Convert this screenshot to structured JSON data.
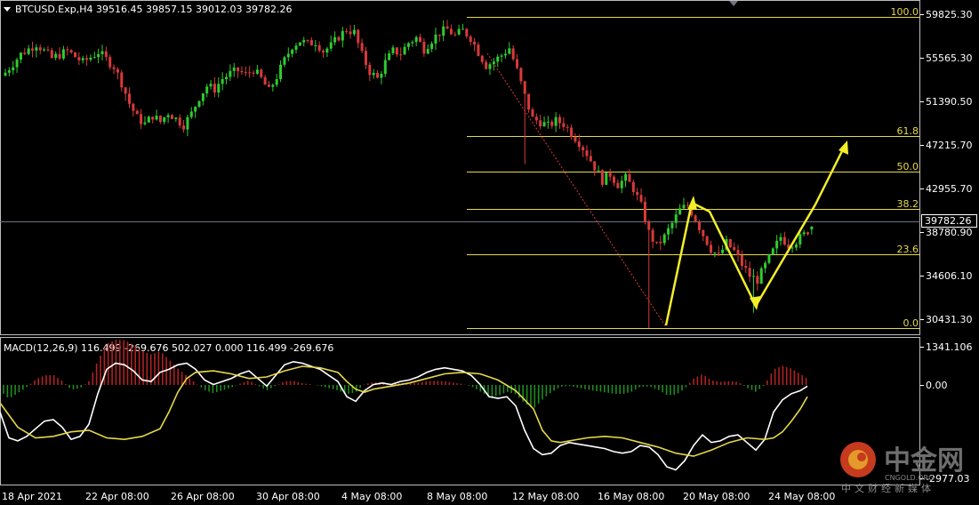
{
  "header": {
    "symbol_line": "BTCUSD.Exp,H4  39516.45 39857.15 39012.03 39782.26"
  },
  "price_axis": {
    "labels": [
      "59825.30",
      "55565.30",
      "51390.50",
      "47215.70",
      "42955.70",
      "38780.90",
      "34606.10",
      "30431.30"
    ],
    "current": "39782.26"
  },
  "fibonacci": {
    "levels": [
      "100.0",
      "61.8",
      "50.0",
      "38.2",
      "23.6",
      "0.0"
    ]
  },
  "macd": {
    "label": "MACD(12,26,9) 116.499 -269.676 502.027 0.000 116.499 -269.676",
    "axis_labels": [
      "1341.106",
      "0.00",
      "-2977.03"
    ]
  },
  "time_axis": {
    "labels": [
      "18 Apr 2021",
      "22 Apr 08:00",
      "26 Apr 08:00",
      "30 Apr 08:00",
      "4 May 08:00",
      "8 May 08:00",
      "12 May 08:00",
      "16 May 08:00",
      "20 May 08:00",
      "24 May 08:00"
    ]
  },
  "watermark": {
    "brand": "中金网",
    "domain": "CNGOLD.ORG",
    "tagline": "中文财经新媒体"
  },
  "colors": {
    "background": "#000000",
    "bull_candle": "#2ecc2e",
    "bear_candle": "#d83a3a",
    "fib_line": "#e6d84a",
    "arrow": "#f2ee2a",
    "macd_hist_pos": "#b02222",
    "macd_hist_neg": "#1e8c1e",
    "macd_line": "#ffffff",
    "signal_line": "#e6d84a",
    "trend_line": "#d83a3a"
  },
  "chart_data": {
    "type": "candlestick",
    "title": "BTCUSD.Exp,H4",
    "timeframe": "H4",
    "last_bar": {
      "open": 39516.45,
      "high": 39857.15,
      "low": 39012.03,
      "close": 39782.26
    },
    "close_path": [
      [
        0,
        54800
      ],
      [
        4,
        56600
      ],
      [
        8,
        57600
      ],
      [
        12,
        56200
      ],
      [
        16,
        56900
      ],
      [
        20,
        55800
      ],
      [
        24,
        56800
      ],
      [
        28,
        55400
      ],
      [
        30,
        53800
      ],
      [
        32,
        51800
      ],
      [
        34,
        50400
      ],
      [
        36,
        49800
      ],
      [
        38,
        50600
      ],
      [
        40,
        50000
      ],
      [
        42,
        50900
      ],
      [
        44,
        50300
      ],
      [
        46,
        49700
      ],
      [
        48,
        50800
      ],
      [
        50,
        52400
      ],
      [
        52,
        53500
      ],
      [
        54,
        53200
      ],
      [
        56,
        54200
      ],
      [
        58,
        54700
      ],
      [
        60,
        55000
      ],
      [
        62,
        54600
      ],
      [
        64,
        55100
      ],
      [
        66,
        54200
      ],
      [
        68,
        53000
      ],
      [
        70,
        54400
      ],
      [
        72,
        56000
      ],
      [
        74,
        57400
      ],
      [
        76,
        57900
      ],
      [
        78,
        57600
      ],
      [
        80,
        57800
      ],
      [
        82,
        56900
      ],
      [
        84,
        57400
      ],
      [
        86,
        58300
      ],
      [
        88,
        59000
      ],
      [
        90,
        58700
      ],
      [
        92,
        56500
      ],
      [
        94,
        54900
      ],
      [
        96,
        54200
      ],
      [
        98,
        55800
      ],
      [
        100,
        56900
      ],
      [
        102,
        56700
      ],
      [
        104,
        57700
      ],
      [
        106,
        58200
      ],
      [
        108,
        57100
      ],
      [
        110,
        58000
      ],
      [
        112,
        58700
      ],
      [
        114,
        59000
      ],
      [
        116,
        58400
      ],
      [
        118,
        58900
      ],
      [
        120,
        58200
      ],
      [
        122,
        56800
      ],
      [
        124,
        55500
      ],
      [
        126,
        55900
      ],
      [
        128,
        56500
      ],
      [
        130,
        57200
      ],
      [
        132,
        55000
      ],
      [
        134,
        52500
      ],
      [
        136,
        50300
      ],
      [
        138,
        50000
      ],
      [
        140,
        49600
      ],
      [
        142,
        50100
      ],
      [
        144,
        49800
      ],
      [
        146,
        48900
      ],
      [
        148,
        48000
      ],
      [
        150,
        46900
      ],
      [
        152,
        45600
      ],
      [
        154,
        44300
      ],
      [
        156,
        44900
      ],
      [
        158,
        43900
      ],
      [
        160,
        44500
      ],
      [
        162,
        43500
      ],
      [
        164,
        41800
      ],
      [
        166,
        39200
      ],
      [
        168,
        37900
      ],
      [
        170,
        38800
      ],
      [
        172,
        40100
      ],
      [
        174,
        41400
      ],
      [
        176,
        41900
      ],
      [
        178,
        40500
      ],
      [
        180,
        39000
      ],
      [
        182,
        37600
      ],
      [
        184,
        36900
      ],
      [
        186,
        38200
      ],
      [
        188,
        37400
      ],
      [
        190,
        36100
      ],
      [
        192,
        35000
      ],
      [
        194,
        34600
      ],
      [
        196,
        36000
      ],
      [
        198,
        37400
      ],
      [
        200,
        38800
      ],
      [
        202,
        38000
      ],
      [
        204,
        38400
      ],
      [
        206,
        39000
      ],
      [
        208,
        39782
      ]
    ],
    "fibonacci": [
      {
        "level": "100.0",
        "price": 59600
      },
      {
        "level": "61.8",
        "price": 47640
      },
      {
        "level": "50.0",
        "price": 43930
      },
      {
        "level": "38.2",
        "price": 40220
      },
      {
        "level": "23.6",
        "price": 35630
      },
      {
        "level": "0.0",
        "price": 28800
      }
    ],
    "price_range": [
      29300,
      61700
    ],
    "macd_params": "12,26,9",
    "macd_values": {
      "main": 116.499,
      "signal": -269.676
    },
    "macd_range": [
      -2977.03,
      1341.106
    ],
    "grid": false
  }
}
